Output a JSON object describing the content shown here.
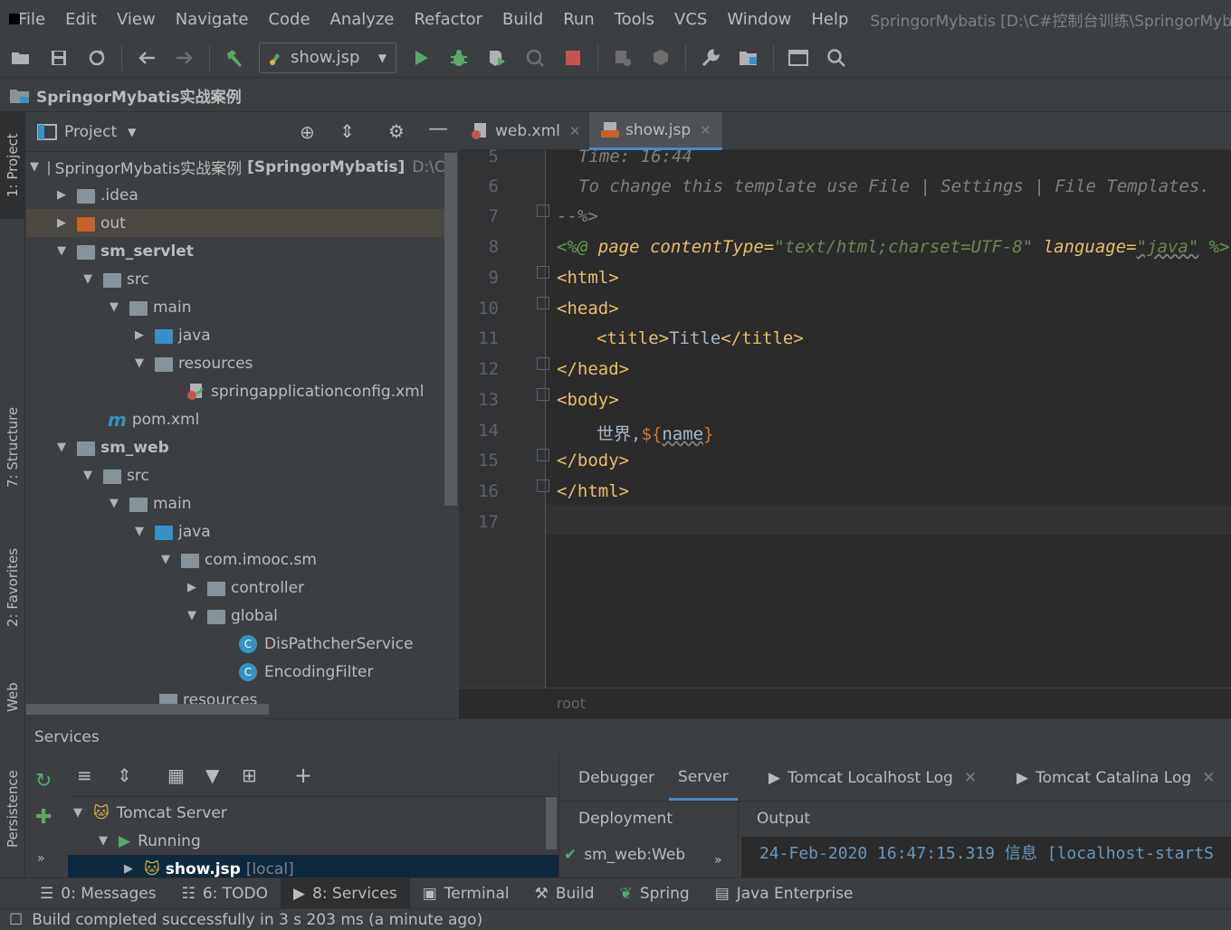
{
  "menu": {
    "items": [
      "File",
      "Edit",
      "View",
      "Navigate",
      "Code",
      "Analyze",
      "Refactor",
      "Build",
      "Run",
      "Tools",
      "VCS",
      "Window",
      "Help"
    ],
    "window_title": "SpringorMybatis [D:\\C#控制台训练\\SpringorMybatis实战"
  },
  "toolbar": {
    "run_config": "show.jsp"
  },
  "breadcrumb": {
    "project": "SpringorMybatis实战案例"
  },
  "stripe": {
    "project": "1: Project",
    "structure": "7: Structure",
    "favorites": "2: Favorites",
    "web": "Web",
    "persistence": "Persistence"
  },
  "project_panel": {
    "title": "Project",
    "tree": [
      {
        "label": "SpringorMybatis实战案例",
        "suffix": "[SpringorMybatis]",
        "path": "D:\\C#"
      },
      {
        "label": ".idea"
      },
      {
        "label": "out"
      },
      {
        "label": "sm_servlet"
      },
      {
        "label": "src"
      },
      {
        "label": "main"
      },
      {
        "label": "java"
      },
      {
        "label": "resources"
      },
      {
        "label": "springapplicationconfig.xml"
      },
      {
        "label": "pom.xml"
      },
      {
        "label": "sm_web"
      },
      {
        "label": "src"
      },
      {
        "label": "main"
      },
      {
        "label": "java"
      },
      {
        "label": "com.imooc.sm"
      },
      {
        "label": "controller"
      },
      {
        "label": "global"
      },
      {
        "label": "DisPathcherService"
      },
      {
        "label": "EncodingFilter"
      },
      {
        "label": "resources"
      }
    ]
  },
  "editor": {
    "tabs": [
      {
        "label": "web.xml"
      },
      {
        "label": "show.jsp"
      }
    ],
    "line_numbers": [
      "5",
      "6",
      "7",
      "8",
      "9",
      "10",
      "11",
      "12",
      "13",
      "14",
      "15",
      "16",
      "17"
    ],
    "lines": {
      "l5": "Time: 16:44",
      "l6": "To change this template use File | Settings | File Templates.",
      "l7": "--%>",
      "l8_a": "<%@ ",
      "l8_b": "page ",
      "l8_c": "contentType=",
      "l8_d": "\"text/html;charset=UTF-8\"",
      "l8_e": " language=",
      "l8_f": "\"java\"",
      "l8_g": " %>",
      "l9": "<html>",
      "l10": "<head>",
      "l11_a": "<title>",
      "l11_b": "Title",
      "l11_c": "</title>",
      "l12": "</head>",
      "l13": "<body>",
      "l14_a": "世界,",
      "l14_b": "$",
      "l14_c": "{",
      "l14_d": "name",
      "l14_e": "}",
      "l15": "</body>",
      "l16": "</html>"
    },
    "breadcrumb": "root"
  },
  "services": {
    "title": "Services",
    "tree": [
      {
        "label": "Tomcat Server"
      },
      {
        "label": "Running"
      },
      {
        "label": "show.jsp",
        "suffix": "[local]"
      }
    ],
    "tabs": [
      "Debugger",
      "Server",
      "Tomcat Localhost Log",
      "Tomcat Catalina Log"
    ],
    "deployment_label": "Deployment",
    "output_label": "Output",
    "deployment_item": "sm_web:Web",
    "output_line": "24-Feb-2020 16:47:15.319 信息 [localhost-startS"
  },
  "bottom_tools": [
    {
      "label": "0: Messages"
    },
    {
      "label": "6: TODO"
    },
    {
      "label": "8: Services"
    },
    {
      "label": "Terminal"
    },
    {
      "label": "Build"
    },
    {
      "label": "Spring"
    },
    {
      "label": "Java Enterprise"
    }
  ],
  "status": {
    "message": "Build completed successfully in 3 s 203 ms (a minute ago)"
  },
  "colors": {
    "accent": "#4a88c7",
    "background": "#3c3f41",
    "editor_bg": "#2b2b2b",
    "selection": "#0d293e"
  }
}
